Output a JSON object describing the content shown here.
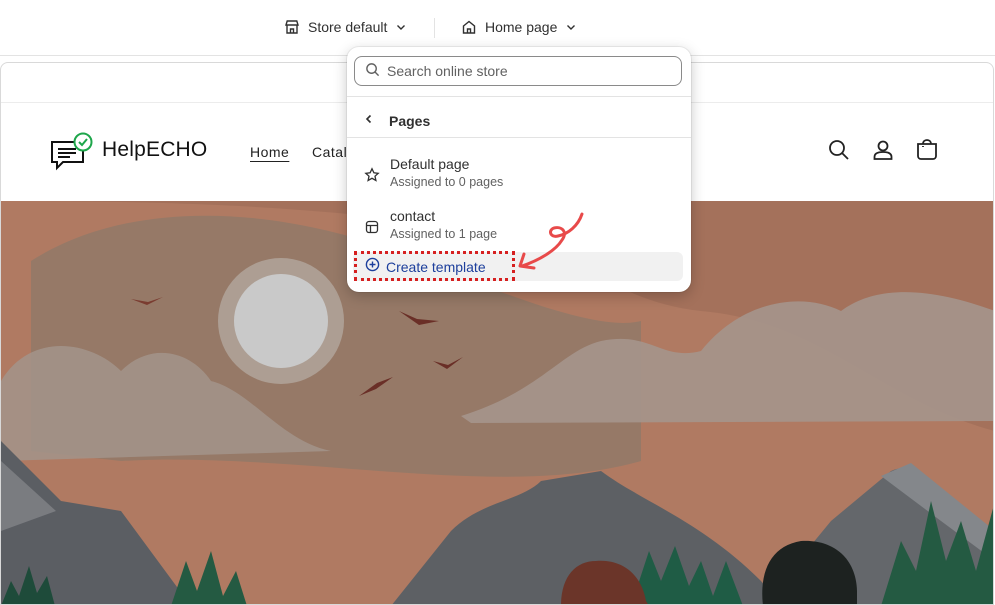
{
  "topbar": {
    "store_selector": {
      "label": "Store default",
      "icon": "store-icon"
    },
    "page_selector": {
      "label": "Home page",
      "icon": "home-icon"
    }
  },
  "storefront": {
    "logo_text": "HelpECHO",
    "nav": [
      {
        "label": "Home"
      },
      {
        "label": "Catalo"
      }
    ],
    "header_icons": [
      "search-icon",
      "account-icon",
      "cart-icon"
    ]
  },
  "dropdown": {
    "search_placeholder": "Search online store",
    "section_title": "Pages",
    "templates": [
      {
        "name": "Default page",
        "assigned": "Assigned to 0 pages",
        "icon": "star-icon"
      },
      {
        "name": "contact",
        "assigned": "Assigned to 1 page",
        "icon": "layout-icon"
      }
    ],
    "create_label": "Create template"
  },
  "colors": {
    "accent_link": "#1d3f9c",
    "annotation_red": "#d62020",
    "hero_sky": "#b07a62"
  }
}
